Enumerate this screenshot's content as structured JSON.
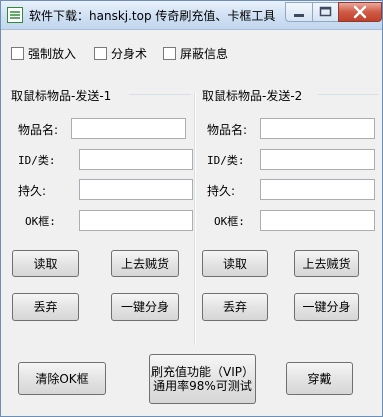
{
  "window": {
    "title": "软件下载：hanskj.top  传奇刷充值、卡框工具"
  },
  "options": [
    {
      "label": "强制放入"
    },
    {
      "label": "分身术"
    },
    {
      "label": "屏蔽信息"
    }
  ],
  "groups": [
    {
      "title": "取鼠标物品-发送-1",
      "fields": [
        {
          "label": "物品名:"
        },
        {
          "label": "ID/类:"
        },
        {
          "label": "持久:"
        },
        {
          "label": "OK框:"
        }
      ],
      "buttons": {
        "read": "读取",
        "upload": "上去贼货",
        "discard": "丢弃",
        "split": "一键分身"
      }
    },
    {
      "title": "取鼠标物品-发送-2",
      "fields": [
        {
          "label": "物品名:"
        },
        {
          "label": "ID/类:"
        },
        {
          "label": "持久:"
        },
        {
          "label": "OK框:"
        }
      ],
      "buttons": {
        "read": "读取",
        "upload": "上去贼货",
        "discard": "丢弃",
        "split": "一键分身"
      }
    }
  ],
  "footer": {
    "clear_ok": "清除OK框",
    "recharge_line1": "刷充值功能（VIP）",
    "recharge_line2": "通用率98%可测试",
    "wear": "穿戴"
  },
  "colors": {
    "close_red": "#c1412b",
    "titlebar": "#cfe0f3",
    "accent_green": "#2e8b3a"
  },
  "icons": {
    "app": "app-icon",
    "minimize": "minimize-icon",
    "maximize": "maximize-icon",
    "close": "close-icon"
  }
}
